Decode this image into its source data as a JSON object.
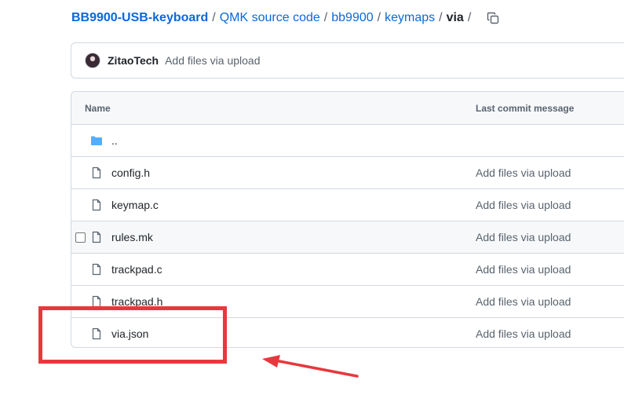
{
  "breadcrumb": {
    "repo": "BB9900-USB-keyboard",
    "segments": [
      "QMK source code",
      "bb9900",
      "keymaps"
    ],
    "current": "via",
    "separator": "/"
  },
  "commit": {
    "author": "ZitaoTech",
    "message": "Add files via upload"
  },
  "table": {
    "headers": {
      "name": "Name",
      "message": "Last commit message"
    },
    "parent_dir": "..",
    "rows": [
      {
        "name": "config.h",
        "message": "Add files via upload",
        "icon": "file-icon"
      },
      {
        "name": "keymap.c",
        "message": "Add files via upload",
        "icon": "file-icon"
      },
      {
        "name": "rules.mk",
        "message": "Add files via upload",
        "icon": "file-icon"
      },
      {
        "name": "trackpad.c",
        "message": "Add files via upload",
        "icon": "file-icon"
      },
      {
        "name": "trackpad.h",
        "message": "Add files via upload",
        "icon": "file-icon"
      },
      {
        "name": "via.json",
        "message": "Add files via upload",
        "icon": "file-icon"
      }
    ]
  },
  "colors": {
    "link": "#0969da",
    "folder": "#54aeff",
    "annotation": "#e8383d"
  }
}
